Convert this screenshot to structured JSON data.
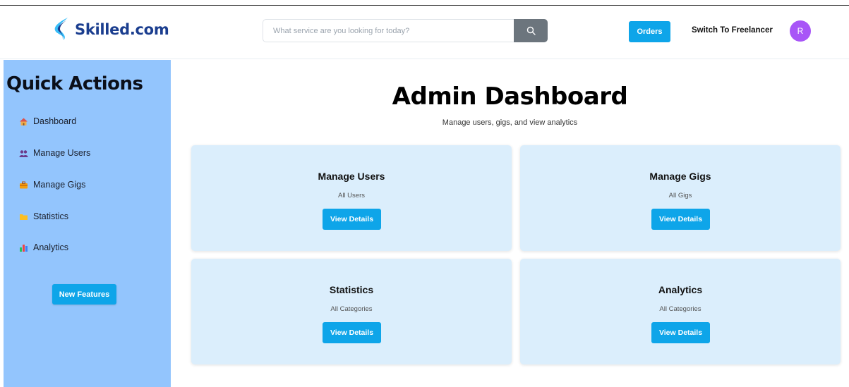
{
  "header": {
    "logo_text": "Skilled.com",
    "search_placeholder": "What service are you looking for today?",
    "orders_label": "Orders",
    "switch_label": "Switch To Freelancer",
    "avatar_initial": "R"
  },
  "sidebar": {
    "title": "Quick Actions",
    "items": [
      {
        "label": "Dashboard",
        "icon": "house-icon"
      },
      {
        "label": "Manage Users",
        "icon": "users-icon"
      },
      {
        "label": "Manage Gigs",
        "icon": "briefcase-icon"
      },
      {
        "label": "Statistics",
        "icon": "folder-icon"
      },
      {
        "label": "Analytics",
        "icon": "bar-chart-icon"
      }
    ],
    "new_features_label": "New Features"
  },
  "main": {
    "title": "Admin Dashboard",
    "subtitle": "Manage users, gigs, and view analytics",
    "cards": [
      {
        "title": "Manage Users",
        "desc": "All Users",
        "button": "View Details"
      },
      {
        "title": "Manage Gigs",
        "desc": "All Gigs",
        "button": "View Details"
      },
      {
        "title": "Statistics",
        "desc": "All Categories",
        "button": "View Details"
      },
      {
        "title": "Analytics",
        "desc": "All Categories",
        "button": "View Details"
      }
    ]
  },
  "colors": {
    "accent": "#0ea5e9",
    "sidebar_bg": "#93c5fd",
    "card_bg": "#dbeefc",
    "avatar_bg": "#a855f7",
    "logo_text": "#1b3e8f"
  }
}
